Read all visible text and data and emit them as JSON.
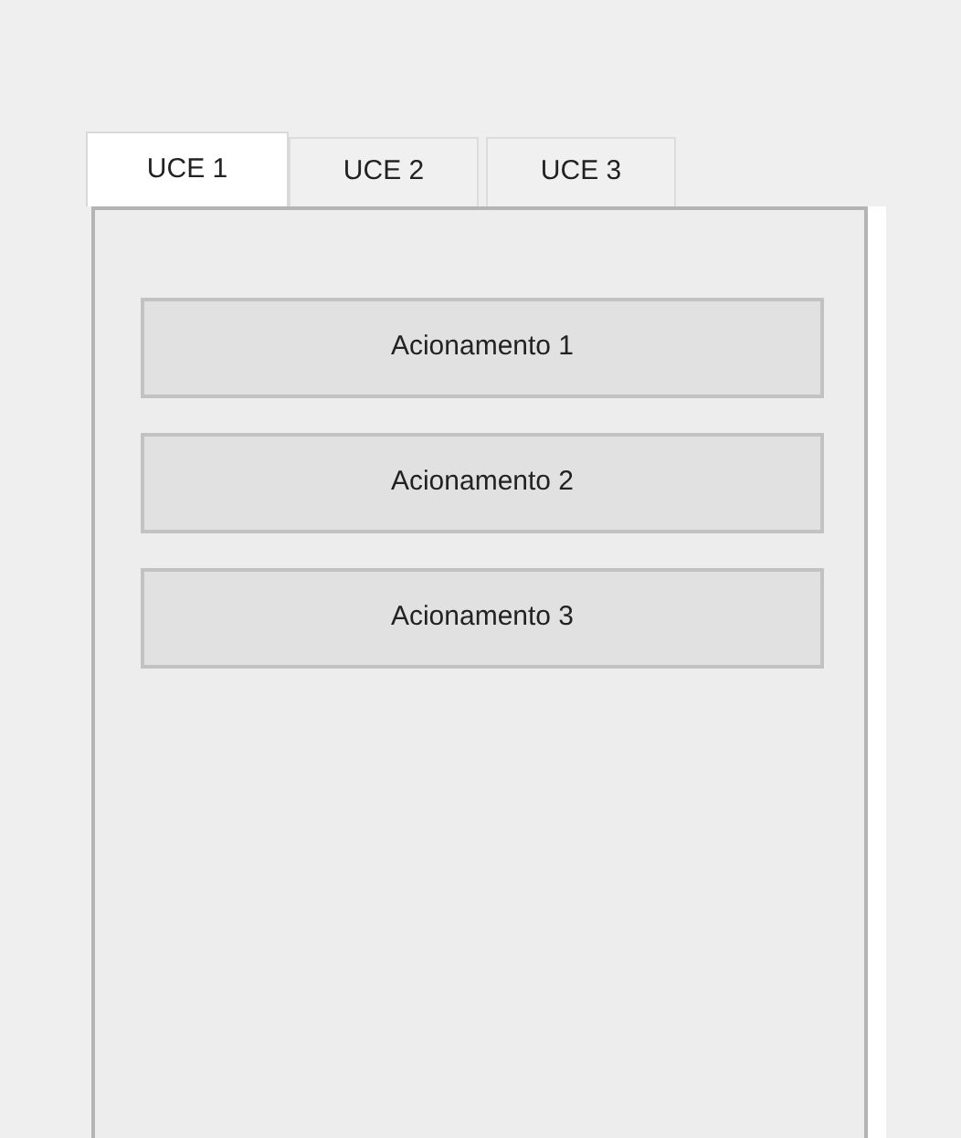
{
  "tabs": [
    {
      "label": "UCE 1",
      "selected": true
    },
    {
      "label": "UCE 2",
      "selected": false
    },
    {
      "label": "UCE 3",
      "selected": false
    }
  ],
  "buttons": [
    "Acionamento 1",
    "Acionamento 2",
    "Acionamento 3"
  ]
}
